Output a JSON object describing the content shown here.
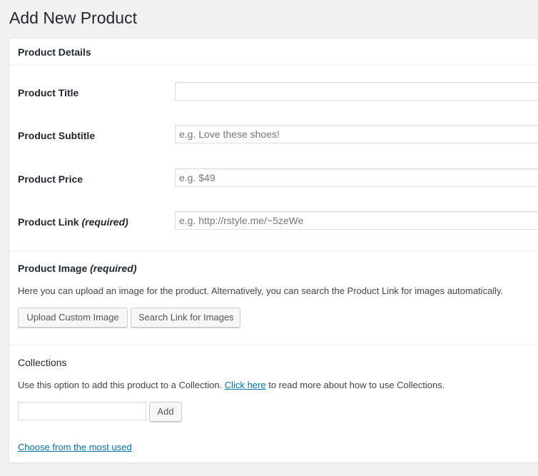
{
  "page": {
    "title": "Add New Product"
  },
  "product_details": {
    "heading": "Product Details",
    "fields": [
      {
        "label": "Product Title",
        "required_note": "",
        "value": "",
        "placeholder": ""
      },
      {
        "label": "Product Subtitle",
        "required_note": "",
        "value": "",
        "placeholder": "e.g. Love these shoes!"
      },
      {
        "label": "Product Price",
        "required_note": "",
        "value": "",
        "placeholder": "e.g. $49"
      },
      {
        "label": "Product Link",
        "required_note": "(required)",
        "value": "",
        "placeholder": "e.g. http://rstyle.me/~5zeWe"
      }
    ]
  },
  "product_image": {
    "title": "Product Image",
    "required_note": "(required)",
    "description": "Here you can upload an image for the product. Alternatively, you can search the Product Link for images automatically.",
    "upload_button": "Upload Custom Image",
    "search_button": "Search Link for Images"
  },
  "collections": {
    "title": "Collections",
    "description_before": "Use this option to add this product to a Collection.",
    "link_text": "Click here",
    "description_after": "to read more about how to use Collections.",
    "input_value": "",
    "add_button": "Add",
    "most_used_link": "Choose from the most used"
  }
}
